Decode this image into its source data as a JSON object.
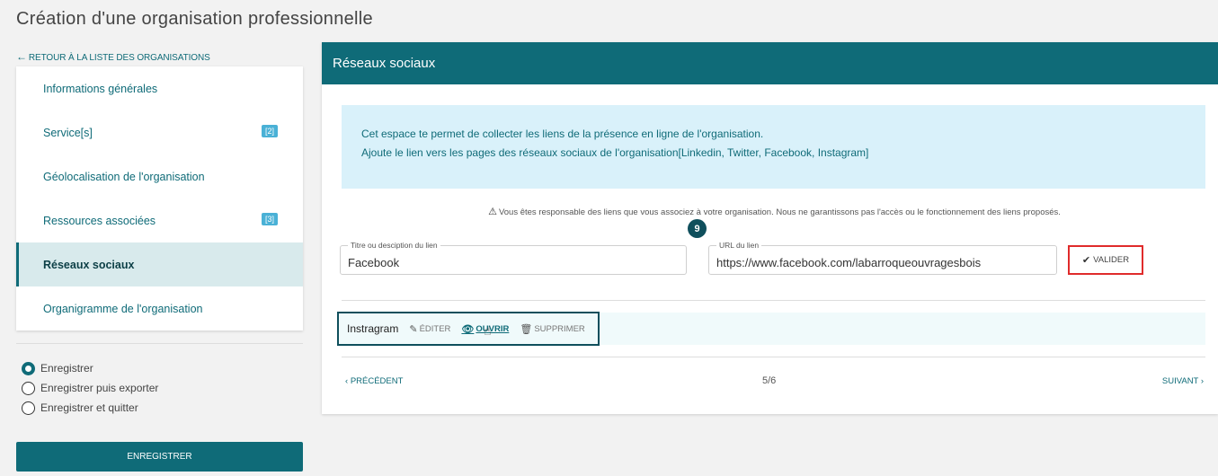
{
  "page": {
    "title": "Création d'une organisation professionnelle"
  },
  "back_link": {
    "label": "RETOUR À LA LISTE DES ORGANISATIONS"
  },
  "sidebar": {
    "items": [
      {
        "label": "Informations générales",
        "badge": ""
      },
      {
        "label": "Service[s]",
        "badge": "[2]"
      },
      {
        "label": "Géolocalisation de l'organisation",
        "badge": ""
      },
      {
        "label": "Ressources associées",
        "badge": "[3]"
      },
      {
        "label": "Réseaux sociaux",
        "badge": "",
        "active": true
      },
      {
        "label": "Organigramme de l'organisation",
        "badge": ""
      }
    ]
  },
  "save_options": {
    "options": [
      "Enregistrer",
      "Enregistrer puis exporter",
      "Enregistrer et quitter"
    ],
    "selected": "Enregistrer"
  },
  "save_button": {
    "label": "ENREGISTRER"
  },
  "main": {
    "title": "Réseaux sociaux",
    "info_line1": "Cet espace te permet de collecter les liens de la présence en ligne de l'organisation.",
    "info_line2": "Ajoute le lien vers les pages des réseaux sociaux de l'organisation[Linkedin, Twitter, Facebook, Instagram]",
    "warning": "Vous êtes responsable des liens que vous associez à votre organisation. Nous ne garantissons pas l'accès ou le fonctionnement des liens proposés.",
    "step_number": "9",
    "form": {
      "title_legend": "Titre ou desciption du lien",
      "title_value": "Facebook",
      "url_legend": "URL du lien",
      "url_value": "https://www.facebook.com/labarroqueouvragesbois",
      "validate_label": "VALIDER"
    },
    "links": [
      {
        "name": "Instragram",
        "edit_label": "ÉDITER",
        "open_label": "OUVRIR",
        "delete_label": "SUPPRIMER"
      }
    ],
    "pager": {
      "prev_label": "PRÉCÉDENT",
      "count": "5/6",
      "next_label": "SUIVANT"
    }
  },
  "colors": {
    "primary": "#0f6b78",
    "info_bg": "#d9f1fa",
    "highlight_border": "#e02b2b",
    "badge": "#4ab1d6"
  },
  "icons": {
    "back": "arrow-left-icon",
    "warning": "warning-triangle-icon",
    "validate": "check-icon",
    "edit": "pencil-icon",
    "open": "eye-icon",
    "delete": "trash-icon",
    "prev": "chevron-left-icon",
    "next": "chevron-right-icon",
    "cursor": "hand-pointer-icon"
  }
}
